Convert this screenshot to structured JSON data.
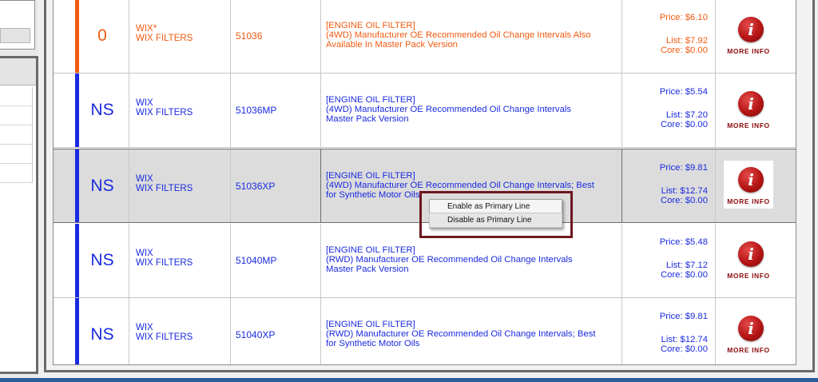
{
  "rows": [
    {
      "status": "0",
      "brand_line1": "WIX*",
      "brand_line2": "WIX FILTERS",
      "part": "51036",
      "desc_line1": "[ENGINE OIL FILTER]",
      "desc_line2": "(4WD) Manufacturer OE Recommended Oil Change Intervals Also",
      "desc_line3": "Available In Master Pack Version",
      "price": "Price: $6.10",
      "list": "List: $7.92",
      "core": "Core: $0.00",
      "info_label": "MORE INFO"
    },
    {
      "status": "NS",
      "brand_line1": "WIX",
      "brand_line2": "WIX FILTERS",
      "part": "51036MP",
      "desc_line1": "[ENGINE OIL FILTER]",
      "desc_line2": "(4WD) Manufacturer OE Recommended Oil Change Intervals",
      "desc_line3": "Master Pack Version",
      "price": "Price: $5.54",
      "list": "List: $7.20",
      "core": "Core: $0.00",
      "info_label": "MORE INFO"
    },
    {
      "status": "NS",
      "brand_line1": "WIX",
      "brand_line2": "WIX FILTERS",
      "part": "51036XP",
      "desc_line1": "[ENGINE OIL FILTER]",
      "desc_line2": "(4WD) Manufacturer OE Recommended Oil Change Intervals; Best",
      "desc_line3": "for Synthetic Motor Oils",
      "price": "Price: $9.81",
      "list": "List: $12.74",
      "core": "Core: $0.00",
      "info_label": "MORE INFO"
    },
    {
      "status": "NS",
      "brand_line1": "WIX",
      "brand_line2": "WIX FILTERS",
      "part": "51040MP",
      "desc_line1": "[ENGINE OIL FILTER]",
      "desc_line2": "(RWD) Manufacturer OE Recommended Oil Change Intervals",
      "desc_line3": "Master Pack Version",
      "price": "Price: $5.48",
      "list": "List: $7.12",
      "core": "Core: $0.00",
      "info_label": "MORE INFO"
    },
    {
      "status": "NS",
      "brand_line1": "WIX",
      "brand_line2": "WIX FILTERS",
      "part": "51040XP",
      "desc_line1": "[ENGINE OIL FILTER]",
      "desc_line2": "(RWD) Manufacturer OE Recommended Oil Change Intervals; Best",
      "desc_line3": "for Synthetic Motor Oils",
      "price": "Price: $9.81",
      "list": "List: $12.74",
      "core": "Core: $0.00",
      "info_label": "MORE INFO"
    }
  ],
  "info_glyph": "i",
  "context_menu": {
    "enable_label": "Enable as Primary Line",
    "disable_label": "Disable as Primary Line"
  },
  "colors": {
    "stocked_orange": "#f05a10",
    "nonstock_blue": "#1a2adf",
    "info_red": "#b51515",
    "highlight_outline": "#6e1620"
  }
}
